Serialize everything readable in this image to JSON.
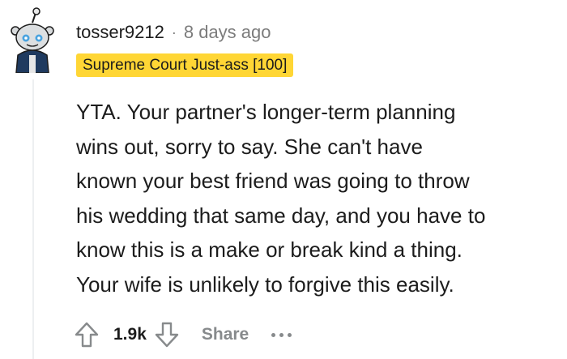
{
  "comment": {
    "author": "tosser9212",
    "separator": "·",
    "timestamp": "8 days ago",
    "flair": "Supreme Court Just-ass [100]",
    "body_lines": [
      "YTA. Your partner's longer-term planning",
      "wins out, sorry to say. She can't have",
      "known your best friend was going to throw",
      "his wedding that same day, and you have to",
      "know this is a make or break kind a thing.",
      "Your wife is unlikely to forgive this easily."
    ],
    "score": "1.9k",
    "share_label": "Share",
    "more_label": "..."
  },
  "colors": {
    "flair_bg": "#ffd635",
    "muted_text": "#7c7c7c",
    "action_text": "#878a8c",
    "avatar_blue": "#4aa3df"
  },
  "icons": {
    "avatar": "snoo-avatar",
    "upvote": "arrow-up-outline-icon",
    "downvote": "arrow-down-outline-icon",
    "more": "ellipsis-icon"
  }
}
